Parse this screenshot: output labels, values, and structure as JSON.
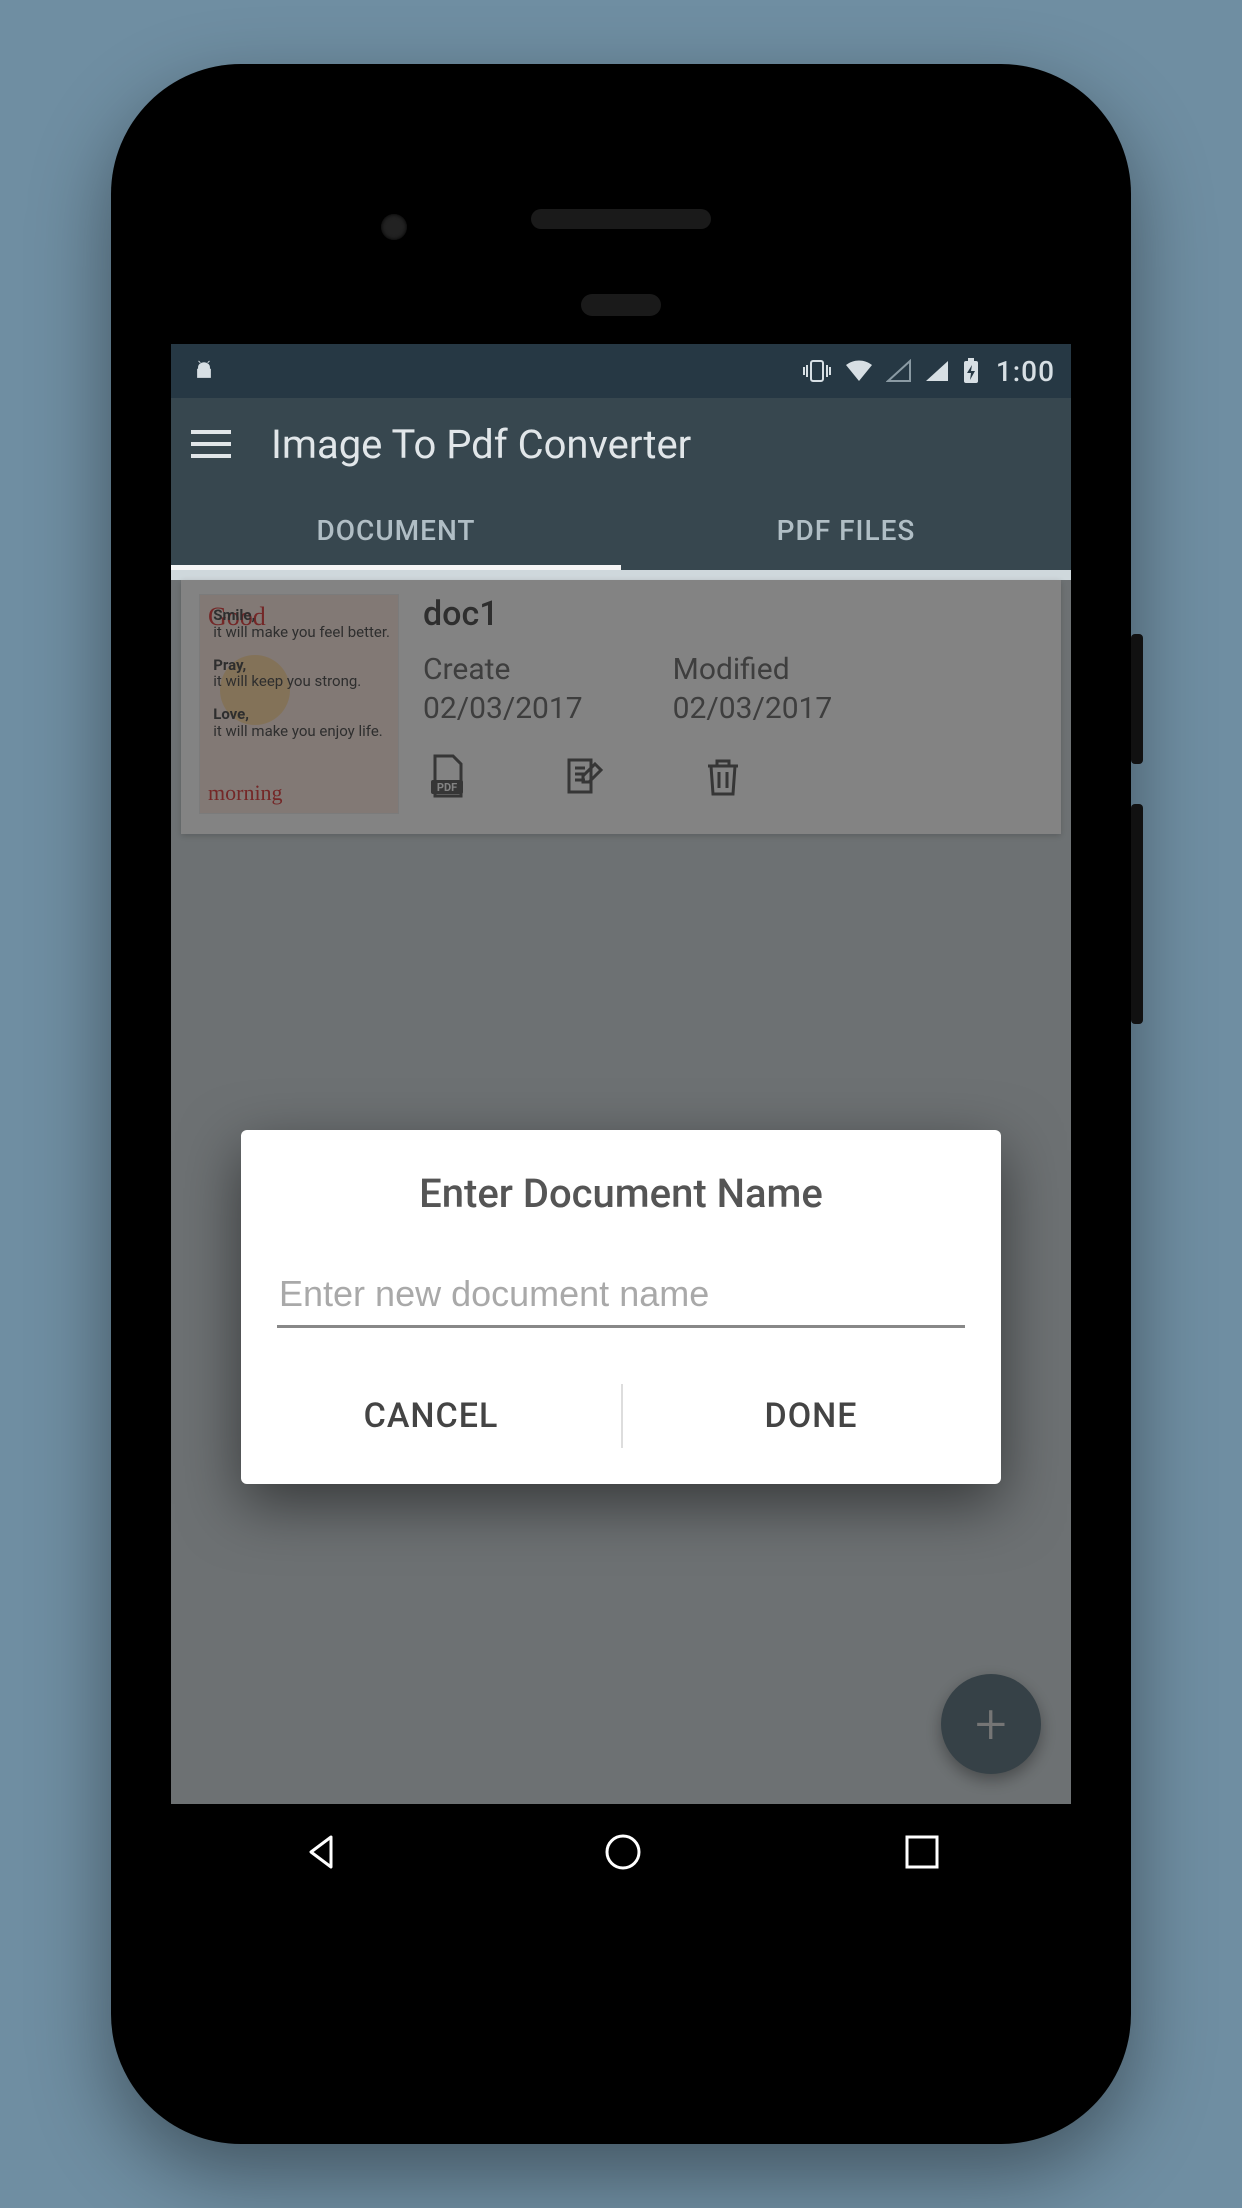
{
  "statusbar": {
    "time": "1:00"
  },
  "appbar": {
    "title": "Image To Pdf Converter"
  },
  "tabs": {
    "document": "DOCUMENT",
    "pdf_files": "PDF FILES"
  },
  "doc": {
    "name": "doc1",
    "create_label": "Create",
    "create_date": "02/03/2017",
    "modified_label": "Modified",
    "modified_date": "02/03/2017"
  },
  "dialog": {
    "title": "Enter Document Name",
    "placeholder": "Enter new document name",
    "cancel": "CANCEL",
    "done": "DONE"
  },
  "thumb": {
    "good": "Good",
    "smile_h": "Smile,",
    "smile": "it will make you feel better.",
    "pray_h": "Pray,",
    "pray": "it will keep you strong.",
    "love_h": "Love,",
    "love": "it will make you enjoy life.",
    "morning": "morning"
  }
}
